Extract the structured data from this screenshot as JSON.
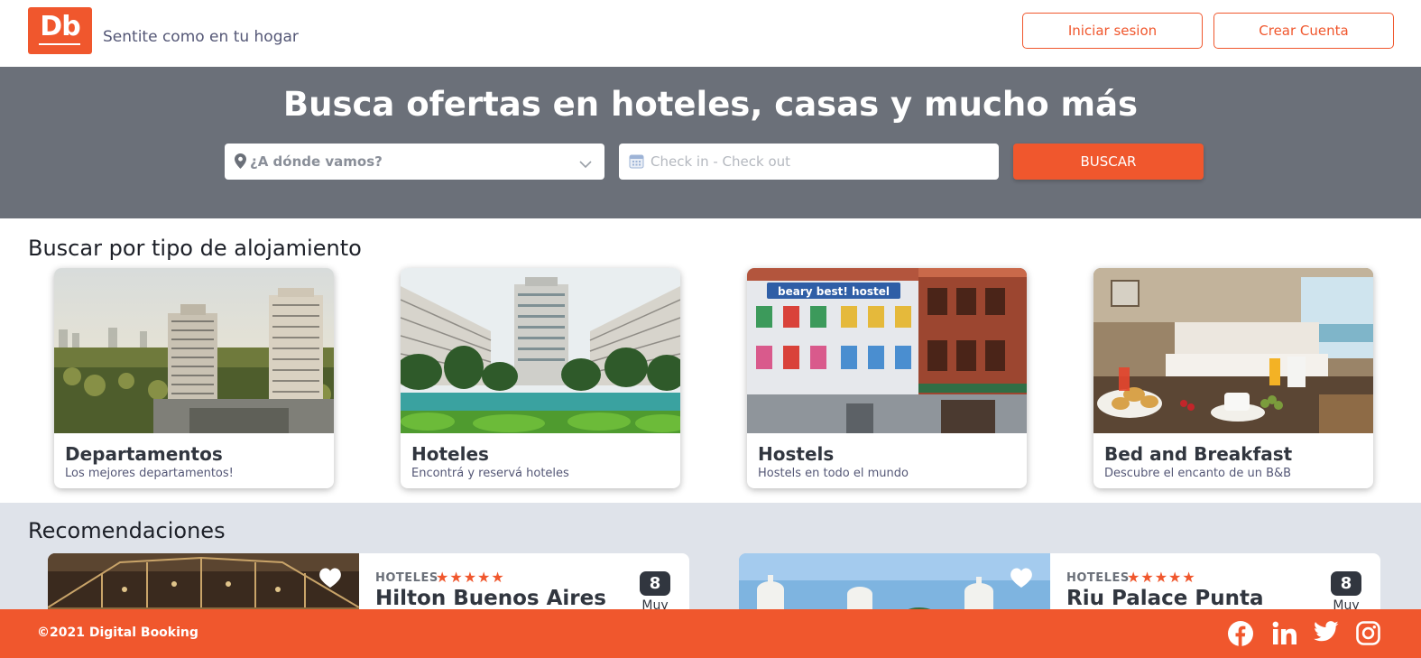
{
  "header": {
    "logo_text": "Db",
    "slogan": "Sentite como en tu hogar",
    "login_label": "Iniciar sesion",
    "create_account_label": "Crear Cuenta"
  },
  "search": {
    "title": "Busca ofertas en hoteles, casas y mucho más",
    "destination_placeholder": "¿A dónde vamos?",
    "dates_placeholder": "Check in - Check out",
    "button_label": "BUSCAR"
  },
  "categories": {
    "title": "Buscar por tipo de alojamiento",
    "items": [
      {
        "title": "Departamentos",
        "subtitle": "Los mejores departamentos!"
      },
      {
        "title": "Hoteles",
        "subtitle": "Encontrá y reservá hoteles"
      },
      {
        "title": "Hostels",
        "subtitle": "Hostels en todo el mundo"
      },
      {
        "title": "Bed and Breakfast",
        "subtitle": "Descubre el encanto de un B&B"
      }
    ],
    "image_signs": {
      "hostel_sign": "beary best! hostel"
    }
  },
  "recommendations": {
    "title": "Recomendaciones",
    "items": [
      {
        "category": "HOTELES",
        "stars": "★★★★★",
        "name": "Hilton Buenos Aires",
        "score": "8",
        "rating_word": "Muy"
      },
      {
        "category": "HOTELES",
        "stars": "★★★★★",
        "name": "Riu Palace Punta",
        "score": "8",
        "rating_word": "Muy"
      }
    ]
  },
  "footer": {
    "copyright": "©2021 Digital Booking",
    "social_icons": [
      "facebook-icon",
      "linkedin-icon",
      "twitter-icon",
      "instagram-icon"
    ]
  },
  "colors": {
    "primary": "#f0572d",
    "dark": "#31363f",
    "search_band": "#6b7079",
    "recommendations_band": "#dfe3ea"
  }
}
